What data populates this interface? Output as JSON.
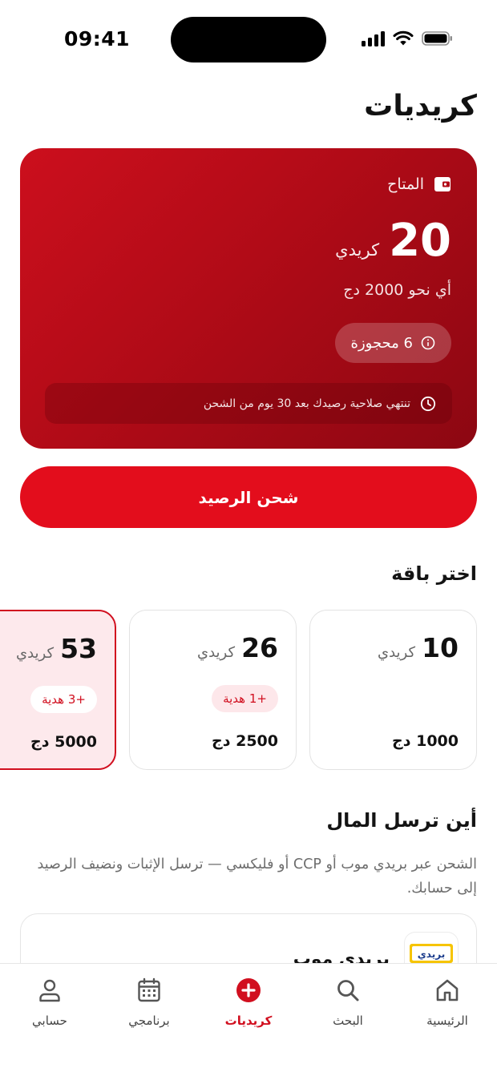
{
  "status_bar": {
    "time": "09:41"
  },
  "header": {
    "title": "كريديات"
  },
  "balance": {
    "label": "المتاح",
    "amount": "20",
    "unit": "كريدي",
    "approx": "أي نحو 2000 دج",
    "reserved": "6 محجوزة",
    "expiry_note": "تنتهي صلاحية رصيدك بعد 30 يوم من الشحن"
  },
  "topup_button": {
    "label": "شحن الرصيد"
  },
  "packages": {
    "title": "اختر باقة",
    "unit": "كريدي",
    "items": [
      {
        "amount": "10",
        "gift": "",
        "price": "1000 دج",
        "selected": false
      },
      {
        "amount": "26",
        "gift": "+1 هدية",
        "price": "2500 دج",
        "selected": false
      },
      {
        "amount": "53",
        "gift": "+3 هدية",
        "price": "5000 دج",
        "selected": true
      }
    ]
  },
  "payment": {
    "title": "أين ترسل المال",
    "description": "الشحن عبر بريدي موب أو CCP أو فليكسي — ترسل الإثبات ونضيف الرصيد إلى حسابك.",
    "methods": [
      {
        "name": "بريدي موب",
        "logo_text": "بريدي",
        "logo_icon": "baridi-mob-logo"
      }
    ]
  },
  "bottom_nav": {
    "items": [
      {
        "label": "الرئيسية",
        "icon": "home-icon"
      },
      {
        "label": "البحث",
        "icon": "search-icon"
      },
      {
        "label": "كريديات",
        "icon": "plus-circle-icon",
        "active": true
      },
      {
        "label": "برنامجي",
        "icon": "calendar-icon"
      },
      {
        "label": "حسابي",
        "icon": "user-icon"
      }
    ]
  },
  "colors": {
    "accent": "#e30d1c",
    "card_dark": "#8c0712",
    "selected_bg": "#fde9ec"
  }
}
